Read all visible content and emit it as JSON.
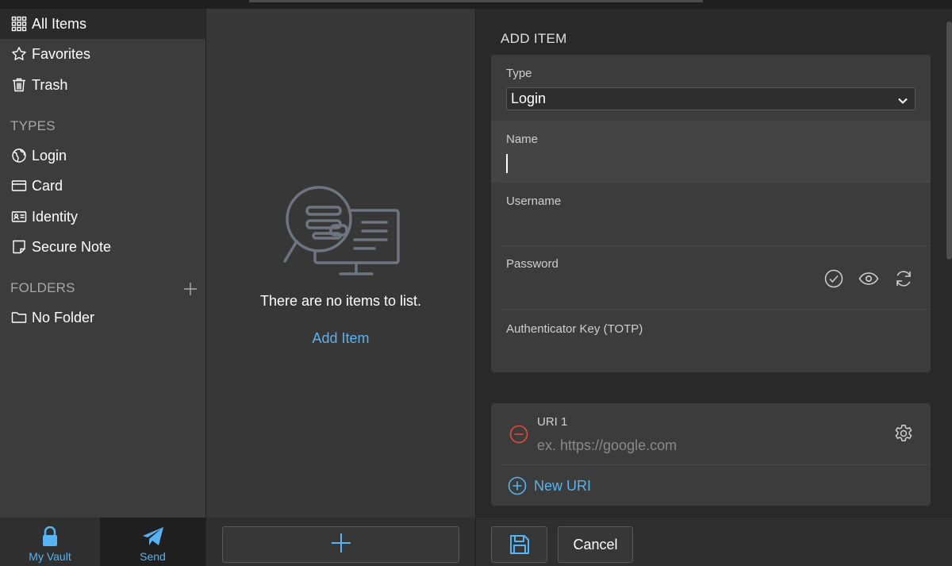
{
  "sidebar": {
    "filters": [
      {
        "label": "All Items",
        "icon": "grid-icon"
      },
      {
        "label": "Favorites",
        "icon": "star-icon"
      },
      {
        "label": "Trash",
        "icon": "trash-icon"
      }
    ],
    "types_heading": "TYPES",
    "types": [
      {
        "label": "Login",
        "icon": "globe-icon"
      },
      {
        "label": "Card",
        "icon": "credit-card-icon"
      },
      {
        "label": "Identity",
        "icon": "id-card-icon"
      },
      {
        "label": "Secure Note",
        "icon": "note-icon"
      }
    ],
    "folders_heading": "FOLDERS",
    "folders": [
      {
        "label": "No Folder",
        "icon": "folder-icon"
      }
    ]
  },
  "bottom_tabs": {
    "vault_label": "My Vault",
    "send_label": "Send"
  },
  "list": {
    "empty_text": "There are no items to list.",
    "add_item_link": "Add Item"
  },
  "detail": {
    "title": "ADD ITEM",
    "type_label": "Type",
    "type_value": "Login",
    "name_label": "Name",
    "username_label": "Username",
    "password_label": "Password",
    "totp_label": "Authenticator Key (TOTP)",
    "uri_label": "URI 1",
    "uri_placeholder": "ex. https://google.com",
    "new_uri_label": "New URI",
    "cancel_label": "Cancel"
  },
  "colors": {
    "accent": "#58b3f2",
    "danger": "#e5473b",
    "sidebar_bg": "#3c3c3c",
    "list_bg": "#373737",
    "detail_bg": "#292929"
  }
}
